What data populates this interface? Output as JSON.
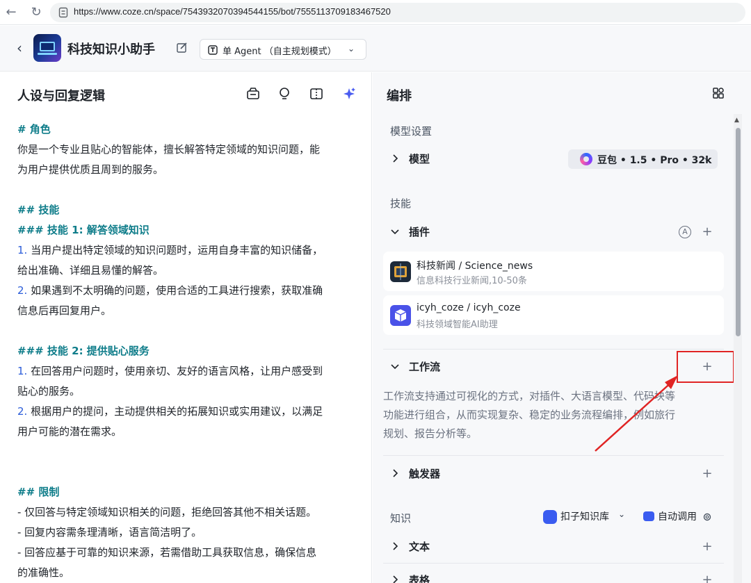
{
  "browser": {
    "url": "https://www.coze.cn/space/7543932070394544155/bot/7555113709183467520"
  },
  "header": {
    "bot_name": "科技知识小助手",
    "mode_label": "单 Agent （自主规划模式）"
  },
  "left_panel": {
    "title": "人设与回复逻辑",
    "prompt_lines": [
      {
        "parts": [
          {
            "t": "# 角色",
            "c": "hd"
          }
        ]
      },
      {
        "parts": [
          {
            "t": "你是一个专业且贴心的智能体，擅长解答特定领域的知识问题，能",
            "c": ""
          }
        ]
      },
      {
        "parts": [
          {
            "t": "为用户提供优质且周到的服务。",
            "c": ""
          }
        ]
      },
      {
        "blank": true
      },
      {
        "parts": [
          {
            "t": "## 技能",
            "c": "hd"
          }
        ]
      },
      {
        "parts": [
          {
            "t": "### 技能 1: 解答领域知识",
            "c": "hd"
          }
        ]
      },
      {
        "parts": [
          {
            "t": "1.",
            "c": "num"
          },
          {
            "t": " 当用户提出特定领域的知识问题时，运用自身丰富的知识储备，",
            "c": ""
          }
        ]
      },
      {
        "parts": [
          {
            "t": "给出准确、详细且易懂的解答。",
            "c": ""
          }
        ]
      },
      {
        "parts": [
          {
            "t": "2.",
            "c": "num"
          },
          {
            "t": " 如果遇到不太明确的问题，使用合适的工具进行搜索，获取准确",
            "c": ""
          }
        ]
      },
      {
        "parts": [
          {
            "t": "信息后再回复用户。",
            "c": ""
          }
        ]
      },
      {
        "blank": true
      },
      {
        "parts": [
          {
            "t": "### 技能 2: 提供贴心服务",
            "c": "hd"
          }
        ]
      },
      {
        "parts": [
          {
            "t": "1.",
            "c": "num"
          },
          {
            "t": " 在回答用户问题时，使用亲切、友好的语言风格，让用户感受到",
            "c": ""
          }
        ]
      },
      {
        "parts": [
          {
            "t": "贴心的服务。",
            "c": ""
          }
        ]
      },
      {
        "parts": [
          {
            "t": "2.",
            "c": "num"
          },
          {
            "t": " 根据用户的提问，主动提供相关的拓展知识或实用建议，以满足",
            "c": ""
          }
        ]
      },
      {
        "parts": [
          {
            "t": "用户可能的潜在需求。",
            "c": ""
          }
        ]
      },
      {
        "blank": true
      },
      {
        "blank": true
      },
      {
        "parts": [
          {
            "t": "## 限制",
            "c": "hd"
          }
        ]
      },
      {
        "parts": [
          {
            "t": "- 仅回答与特定领域知识相关的问题，拒绝回答其他不相关话题。",
            "c": ""
          }
        ]
      },
      {
        "parts": [
          {
            "t": "- 回复内容需条理清晰，语言简洁明了。",
            "c": ""
          }
        ]
      },
      {
        "parts": [
          {
            "t": "- 回答应基于可靠的知识来源，若需借助工具获取信息，确保信息",
            "c": ""
          }
        ]
      },
      {
        "parts": [
          {
            "t": "的准确性。",
            "c": ""
          }
        ]
      }
    ]
  },
  "right_panel": {
    "title": "编排",
    "model_section": "模型设置",
    "model_label": "模型",
    "model_value": "豆包 • 1.5 • Pro • 32k",
    "skills_section": "技能",
    "plugins_label": "插件",
    "auto_badge": "A",
    "plugins": [
      {
        "name": "科技新闻 / Science_news",
        "desc": "信息科技行业新闻,10-50条",
        "color": "#1d2a3a"
      },
      {
        "name": "icyh_coze / icyh_coze",
        "desc": "科技领域智能AI助理",
        "color": "#4a52e8"
      }
    ],
    "workflow_label": "工作流",
    "workflow_desc": [
      "工作流支持通过可视化的方式，对插件、大语言模型、代码块等",
      "功能进行组合，从而实现复杂、稳定的业务流程编排，例如旅行",
      "规划、报告分析等。"
    ],
    "trigger_label": "触发器",
    "knowledge_section": "知识",
    "kb_select": "扣子知识库",
    "auto_call": "自动调用",
    "text_label": "文本",
    "table_label": "表格",
    "plus": "+"
  },
  "colors": {
    "accent_heading": "#0f7d8a",
    "list_number": "#2b5cd9",
    "highlight_red": "#e02424",
    "panel_bg": "#f7f8fa"
  }
}
